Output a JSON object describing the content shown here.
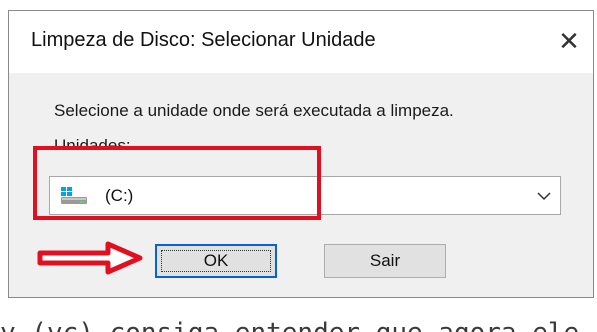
{
  "dialog": {
    "title": "Limpeza de Disco: Selecionar Unidade",
    "close_glyph": "✕",
    "instruction": "Selecione a unidade onde será executada a limpeza.",
    "units_label": "Unidades:",
    "drive": {
      "label": "(C:)",
      "icon": "drive-icon"
    },
    "buttons": {
      "ok": "OK",
      "exit": "Sair"
    }
  },
  "background": {
    "text": "y (vc) consiga entender que agora ele (o"
  },
  "colors": {
    "highlight": "#e01020",
    "arrow": "#e01020",
    "focus_border": "#0a64c8",
    "dialog_bg": "#f0f0f0"
  }
}
